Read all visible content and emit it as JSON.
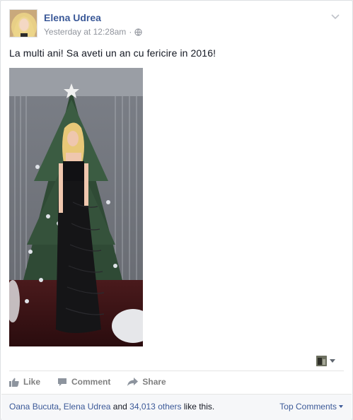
{
  "post": {
    "author": "Elena Udrea",
    "timestamp": "Yesterday at 12:28am",
    "separator": "·",
    "privacy_icon": "globe-icon",
    "text": "La multi ani! Sa aveti un an cu fericire in 2016!",
    "options_icon": "chevron-down-icon"
  },
  "actions": {
    "like_label": "Like",
    "comment_label": "Comment",
    "share_label": "Share"
  },
  "likes": {
    "name1": "Oana Bucuta",
    "comma": ", ",
    "name2": "Elena Udrea",
    "and": " and ",
    "others": "34,013 others",
    "suffix": " like this.",
    "top_comments_label": "Top Comments"
  },
  "colors": {
    "link": "#3b5998",
    "muted": "#90949c",
    "action": "#7f7f7f",
    "footer_bg": "#f6f7f9"
  }
}
